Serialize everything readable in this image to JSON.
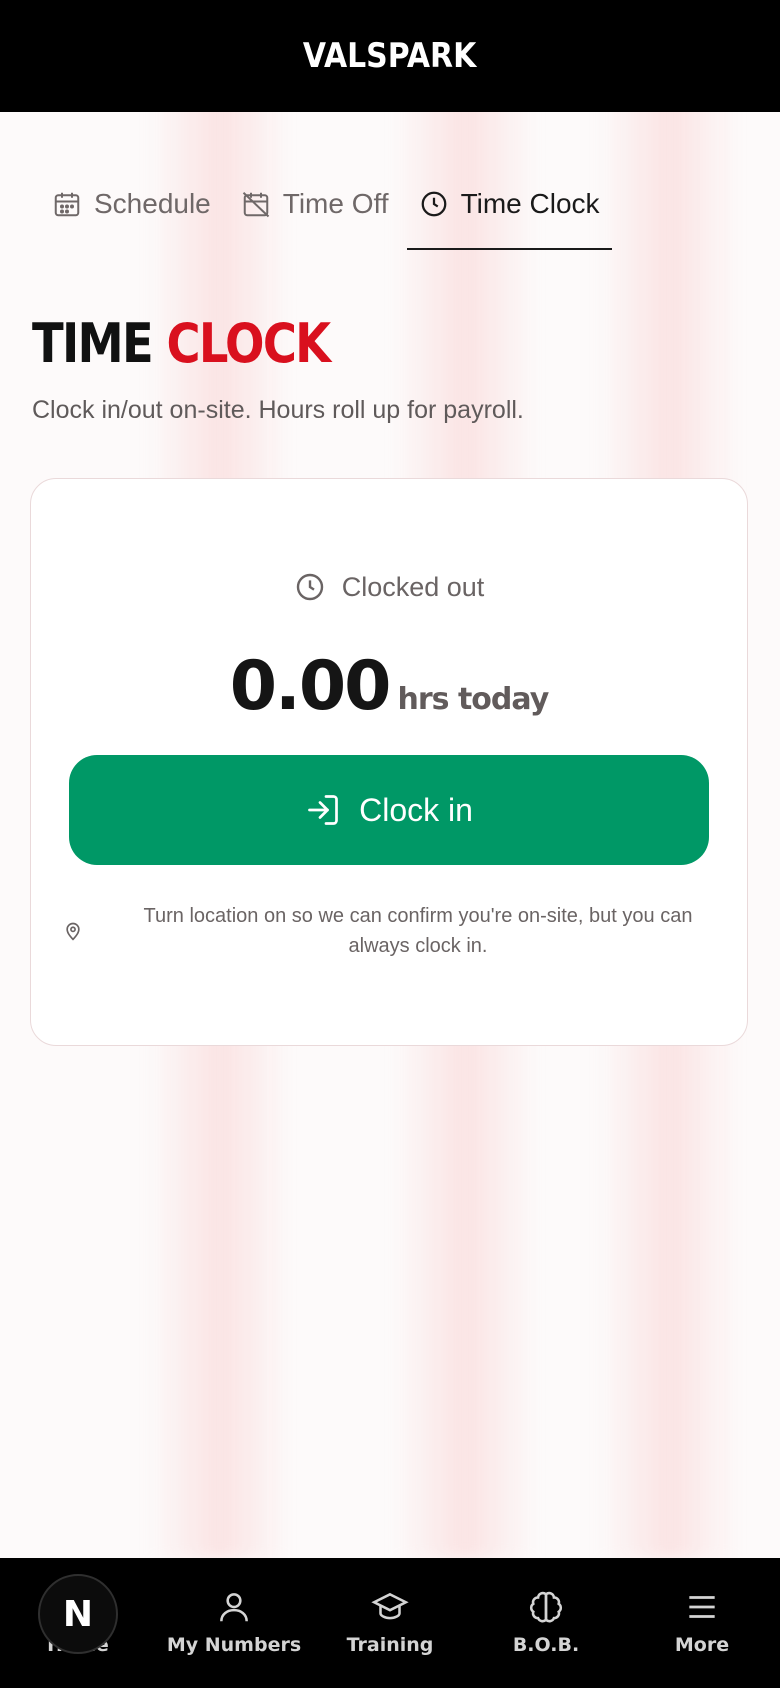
{
  "app": {
    "brand": "VALSPARK"
  },
  "tabs": [
    {
      "label": "Schedule",
      "icon": "calendar-icon",
      "active": false
    },
    {
      "label": "Time Off",
      "icon": "calendar-off-icon",
      "active": false
    },
    {
      "label": "Time Clock",
      "icon": "clock-icon",
      "active": true
    }
  ],
  "page": {
    "title_part1": "TIME",
    "title_part2": "CLOCK",
    "subtitle": "Clock in/out on-site. Hours roll up for payroll."
  },
  "card": {
    "status": "Clocked out",
    "hours_value": "0.00",
    "hours_unit": "hrs today",
    "button_label": "Clock in",
    "location_note": "Turn location on so we can confirm you're on-site, but you can always clock in."
  },
  "bottom_nav": [
    {
      "label": "Home",
      "icon": "home-icon"
    },
    {
      "label": "My Numbers",
      "icon": "user-icon"
    },
    {
      "label": "Training",
      "icon": "graduation-cap-icon"
    },
    {
      "label": "B.O.B.",
      "icon": "brain-icon"
    },
    {
      "label": "More",
      "icon": "menu-icon"
    }
  ],
  "fab": {
    "letter": "N"
  },
  "colors": {
    "accent_red": "#d9101e",
    "clock_in_green": "#009866",
    "bar_black": "#000000"
  }
}
